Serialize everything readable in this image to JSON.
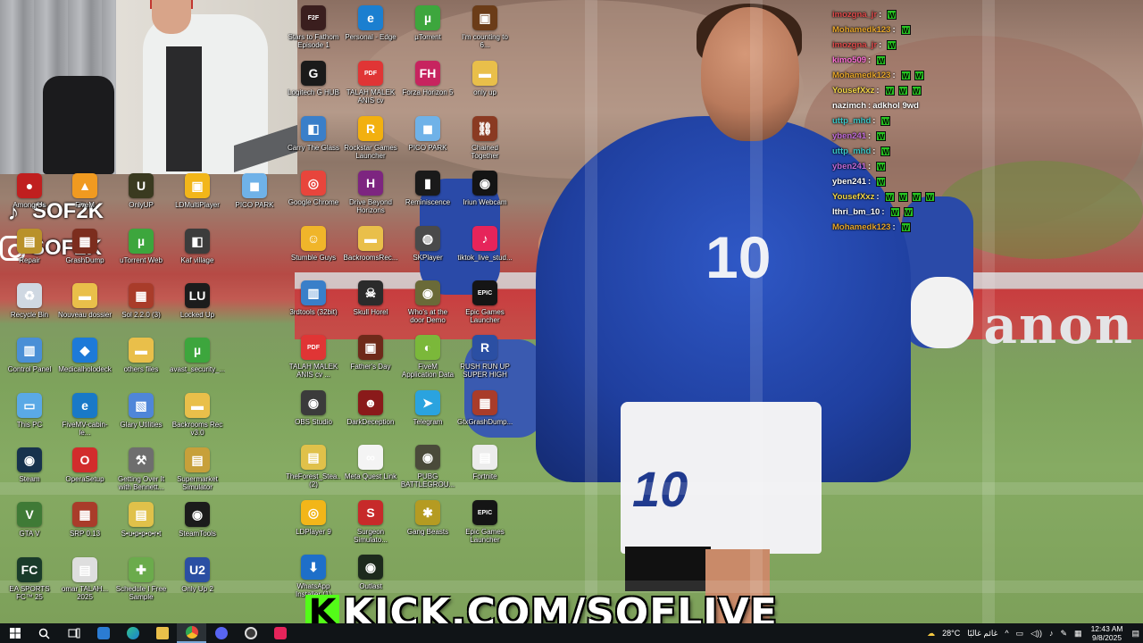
{
  "stream": {
    "social": [
      {
        "icon": "tiktok-icon",
        "handle": "SOF2K"
      },
      {
        "icon": "instagram-icon",
        "handle": "SOF2K"
      }
    ],
    "kick_banner": "KICK.COM/SOFLIVE",
    "kick_logo": "K",
    "wallpaper_banner_text": "anon"
  },
  "desktop_icons": [
    {
      "label": "Among Us",
      "color": "#c01f1f",
      "glyph": "●"
    },
    {
      "label": "FiveM",
      "color": "#f09a20",
      "glyph": "▲"
    },
    {
      "label": "OnlyUP",
      "color": "#3a3a20",
      "glyph": "U"
    },
    {
      "label": "LDMultiPlayer",
      "color": "#f2b619",
      "glyph": "▣"
    },
    {
      "label": "PICO PARK",
      "color": "#6fb2e8",
      "glyph": "◼"
    },
    {
      "label": "Repair",
      "color": "#b9912a",
      "glyph": "▤"
    },
    {
      "label": "GrashDump",
      "color": "#7c2d1e",
      "glyph": "▦"
    },
    {
      "label": "uTorrent Web",
      "color": "#3da63d",
      "glyph": "µ"
    },
    {
      "label": "Kaf village",
      "color": "#3c3c3c",
      "glyph": "◧"
    },
    {
      "label": "Recycle Bin",
      "color": "#cfd8e2",
      "glyph": "♻"
    },
    {
      "label": "Nouveau dossier",
      "color": "#e9bf4a",
      "glyph": "▬"
    },
    {
      "label": "Sol 2.2.0 (3)",
      "color": "#a93c2a",
      "glyph": "▦"
    },
    {
      "label": "Locked Up",
      "color": "#1c1c1c",
      "glyph": "LU"
    },
    {
      "label": "Control Panel",
      "color": "#4a8fd6",
      "glyph": "▥"
    },
    {
      "label": "Medicalholodeck",
      "color": "#1d7ad8",
      "glyph": "◆"
    },
    {
      "label": "others files",
      "color": "#e9bf4a",
      "glyph": "▬"
    },
    {
      "label": "avast_security_...",
      "color": "#3da63d",
      "glyph": "µ"
    },
    {
      "label": "This PC",
      "color": "#5aa9e6",
      "glyph": "▭"
    },
    {
      "label": "FiveMV-cabin-le...",
      "color": "#1979c7",
      "glyph": "e"
    },
    {
      "label": "Glary Utilities",
      "color": "#4f86d9",
      "glyph": "▧"
    },
    {
      "label": "Backrooms Rec v3.0",
      "color": "#e9bf4a",
      "glyph": "▬"
    },
    {
      "label": "Steam",
      "color": "#17324d",
      "glyph": "◉"
    },
    {
      "label": "OperaSetup",
      "color": "#d22c2c",
      "glyph": "O"
    },
    {
      "label": "Getting Over It with Bennett...",
      "color": "#6e6e6e",
      "glyph": "⚒"
    },
    {
      "label": "Supermarket Simulator",
      "color": "#c7a03a",
      "glyph": "▤"
    },
    {
      "label": "GTA V",
      "color": "#3f7a36",
      "glyph": "V"
    },
    {
      "label": "SRP 0.13",
      "color": "#a93c2a",
      "glyph": "▦"
    },
    {
      "label": "S•u•p•p•o•r•t",
      "color": "#e0c14a",
      "glyph": "▤"
    },
    {
      "label": "SteamTools",
      "color": "#1b1b1b",
      "glyph": "◉"
    },
    {
      "label": "EA SPORTS FC™ 25",
      "color": "#1a3b2a",
      "glyph": "FC"
    },
    {
      "label": "omar TALAH... 2025",
      "color": "#dedede",
      "glyph": "▤"
    },
    {
      "label": "Schedule I Free Sample",
      "color": "#6bab4c",
      "glyph": "✚"
    },
    {
      "label": "Only Up 2",
      "color": "#2b4fa3",
      "glyph": "U2"
    },
    {
      "label": "Stars to Fathom Episode 1",
      "color": "#3a1e1e",
      "glyph": "F2F"
    },
    {
      "label": "Personal - Edge",
      "color": "#1b7fd0",
      "glyph": "e"
    },
    {
      "label": "µTorrent",
      "color": "#3da63d",
      "glyph": "µ"
    },
    {
      "label": "I'm counting to 6...",
      "color": "#6b3c18",
      "glyph": "▣"
    },
    {
      "label": "Logitech G HUB",
      "color": "#1a1a1a",
      "glyph": "G"
    },
    {
      "label": "TALAH MALEK ANIS cv",
      "color": "#e03535",
      "glyph": "PDF"
    },
    {
      "label": "Forza Horizon 5",
      "color": "#c7245f",
      "glyph": "FH"
    },
    {
      "label": "only up",
      "color": "#e9bf4a",
      "glyph": "▬"
    },
    {
      "label": "Carry The Glass",
      "color": "#3a7fc9",
      "glyph": "◧"
    },
    {
      "label": "Rockstar Games Launcher",
      "color": "#f2b00f",
      "glyph": "R"
    },
    {
      "label": "PICO PARK",
      "color": "#6fb2e8",
      "glyph": "◼"
    },
    {
      "label": "Chained Together",
      "color": "#8a3a22",
      "glyph": "⛓"
    },
    {
      "label": "Google Chrome",
      "color": "#e8453c",
      "glyph": "◎"
    },
    {
      "label": "Drive Beyond Horizons",
      "color": "#7d2580",
      "glyph": "H"
    },
    {
      "label": "Reminiscence",
      "color": "#1a1a1a",
      "glyph": "▮"
    },
    {
      "label": "Iriun Webcam",
      "color": "#141414",
      "glyph": "◉"
    },
    {
      "label": "Stumble Guys",
      "color": "#f0b52a",
      "glyph": "☺"
    },
    {
      "label": "BackroomsRec...",
      "color": "#e9bf4a",
      "glyph": "▬"
    },
    {
      "label": "SKPlayer",
      "color": "#4a4a4a",
      "glyph": "◍"
    },
    {
      "label": "tiktok_live_stud...",
      "color": "#e6245a",
      "glyph": "♪"
    },
    {
      "label": "3rdtools (32bit)",
      "color": "#3a7fc9",
      "glyph": "▥"
    },
    {
      "label": "Skull Horel",
      "color": "#2b2b2b",
      "glyph": "☠"
    },
    {
      "label": "Who's at the door Demo",
      "color": "#6a6a38",
      "glyph": "◉"
    },
    {
      "label": "Epic Games Launcher",
      "color": "#151515",
      "glyph": "EPIC"
    },
    {
      "label": "TALAH MALEK ANIS cv ...",
      "color": "#e03535",
      "glyph": "PDF"
    },
    {
      "label": "Father's Day",
      "color": "#6e2a1a",
      "glyph": "▣"
    },
    {
      "label": "FiveM Application Data",
      "color": "#7bb83a",
      "glyph": "◐"
    },
    {
      "label": "RUSH RUN UP SUPER HIGH",
      "color": "#2b4fa3",
      "glyph": "R"
    },
    {
      "label": "OBS Studio",
      "color": "#3b3b3b",
      "glyph": "◉"
    },
    {
      "label": "DarkDeception",
      "color": "#8a1a1a",
      "glyph": "☻"
    },
    {
      "label": "Telegram",
      "color": "#2aa3df",
      "glyph": "➤"
    },
    {
      "label": "GtxGrashDump...",
      "color": "#a93c2a",
      "glyph": "▦"
    },
    {
      "label": "TheForest_Stea... (2)",
      "color": "#e0c14a",
      "glyph": "▤"
    },
    {
      "label": "Meta Quest Link",
      "color": "#f4f4f4",
      "glyph": "∞"
    },
    {
      "label": "PUBG BATTLEGROU...",
      "color": "#4a4a3a",
      "glyph": "◉"
    },
    {
      "label": "Fortnite",
      "color": "#ececec",
      "glyph": "▤"
    },
    {
      "label": "LDPlayer 9",
      "color": "#f2b619",
      "glyph": "◎"
    },
    {
      "label": "Surgeon Simulato...",
      "color": "#c72a2a",
      "glyph": "S"
    },
    {
      "label": "Gang Beasts",
      "color": "#b59b22",
      "glyph": "✱"
    },
    {
      "label": "Epic Games Launcher",
      "color": "#151515",
      "glyph": "EPIC"
    },
    {
      "label": "WhatsApp Installer (1)",
      "color": "#1e6fc9",
      "glyph": "⬇"
    },
    {
      "label": "Outlast",
      "color": "#1d2a1d",
      "glyph": "◉"
    }
  ],
  "chat": [
    {
      "user": "imozgna_jr",
      "color": "#e04a4a",
      "msg": "",
      "w": 1
    },
    {
      "user": "Mohamedk123",
      "color": "#e6a52a",
      "msg": "",
      "w": 1
    },
    {
      "user": "imozgna_jr",
      "color": "#e04a4a",
      "msg": "",
      "w": 1
    },
    {
      "user": "kimo509",
      "color": "#ff6fd8",
      "msg": "",
      "w": 1
    },
    {
      "user": "Mohamedk123",
      "color": "#e6a52a",
      "msg": "",
      "w": 2
    },
    {
      "user": "YousefXxz",
      "color": "#f2d545",
      "msg": "",
      "w": 3
    },
    {
      "user": "nazimch",
      "color": "#ffffff",
      "msg": "adkhol 9wd",
      "w": 0
    },
    {
      "user": "uttp_mhd",
      "color": "#3ac7c7",
      "msg": "",
      "w": 1
    },
    {
      "user": "yben241",
      "color": "#c06ad8",
      "msg": "",
      "w": 1
    },
    {
      "user": "uttp_mhd",
      "color": "#3ac7c7",
      "msg": "",
      "w": 1
    },
    {
      "user": "yben241",
      "color": "#c06ad8",
      "msg": "",
      "w": 1
    },
    {
      "user": "yben241",
      "color": "#ffffff",
      "msg": "",
      "w": 1
    },
    {
      "user": "YousefXxz",
      "color": "#f2d545",
      "msg": "",
      "w": 4
    },
    {
      "user": "lthri_bm_10",
      "color": "#ffffff",
      "msg": "",
      "w": 2
    },
    {
      "user": "Mohamedk123",
      "color": "#e6a52a",
      "msg": "",
      "w": 1
    }
  ],
  "chat_emote": "W",
  "taskbar": {
    "weather_temp": "28°C",
    "weather_text": "غائم غالبًا",
    "time": "12:43 AM",
    "date": "9/8/2025",
    "tray_arrow": "^"
  }
}
